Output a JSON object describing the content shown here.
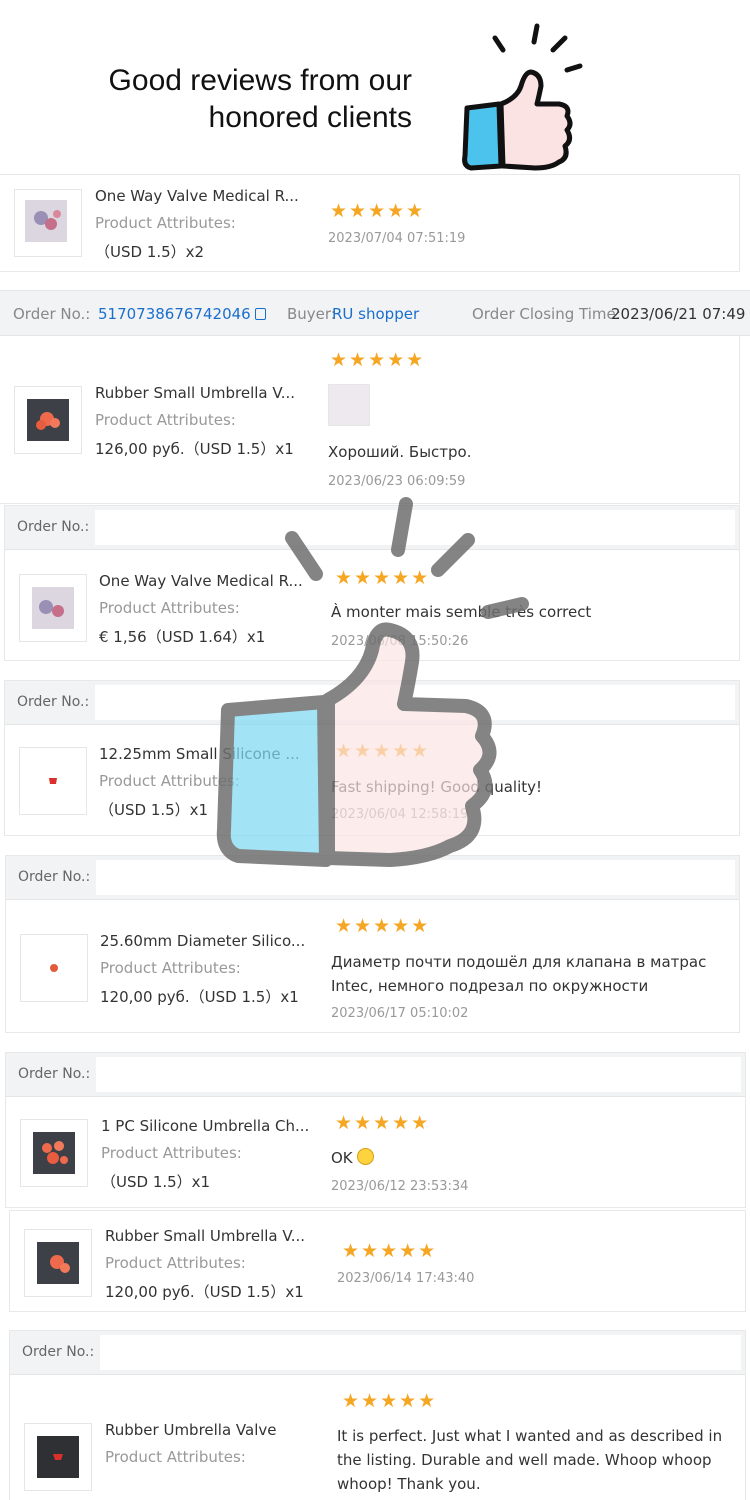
{
  "header": {
    "title_line1": "Good reviews from our",
    "title_line2": "honored clients"
  },
  "reviews": [
    {
      "name": "One Way Valve Medical R...",
      "attr": "Product Attributes:",
      "price": "（USD  1.5）x2",
      "stars": "★★★★★",
      "text": "",
      "date": "2023/07/04 07:51:19"
    },
    {
      "name": "Rubber Small Umbrella V...",
      "attr": "Product Attributes:",
      "price": "126,00 руб.（USD  1.5）x1",
      "stars": "★★★★★",
      "text": "Хороший. Быстро.",
      "date": "2023/06/23 06:09:59"
    },
    {
      "name": "One Way Valve Medical R...",
      "attr": "Product Attributes:",
      "price": "€ 1,56（USD  1.64）x1",
      "stars": "★★★★★",
      "text": "À monter mais semble très correct",
      "date": "2023/06/08 15:50:26"
    },
    {
      "name": "12.25mm Small Silicone ...",
      "attr": "Product Attributes:",
      "price": "（USD  1.5）x1",
      "stars": "★★★★★",
      "text": "Fast shipping! Good quality!",
      "date": "2023/06/04 12:58:19"
    },
    {
      "name": "25.60mm Diameter Silico...",
      "attr": "Product Attributes:",
      "price": "120,00 руб.（USD  1.5）x1",
      "stars": "★★★★★",
      "text": "Диаметр почти подошёл для клапана в матрас Intec, немного подрезал по окружности",
      "date": "2023/06/17 05:10:02"
    },
    {
      "name": "1 PC Silicone Umbrella Ch...",
      "attr": "Product Attributes:",
      "price": "（USD  1.5）x1",
      "stars": "★★★★★",
      "text": "OK",
      "date": "2023/06/12 23:53:34"
    },
    {
      "name": "Rubber Small Umbrella V...",
      "attr": "Product Attributes:",
      "price": "120,00 руб.（USD  1.5）x1",
      "stars": "★★★★★",
      "text": "",
      "date": "2023/06/14 17:43:40"
    },
    {
      "name": "Rubber Umbrella Valve",
      "attr": "Product Attributes:",
      "price": "",
      "stars": "★★★★★",
      "text": "It is perfect. Just what I wanted and as described in the listing. Durable and well made. Whoop whoop whoop! Thank you.",
      "date": ""
    }
  ],
  "order_info": {
    "order_label": "Order No.:",
    "order_number": "5170738676742046",
    "buyer_label": "Buyer:",
    "buyer_name": "RU shopper",
    "closing_label": "Order Closing Time:",
    "closing_time": "2023/06/21 07:49"
  },
  "order_bar_label": "Order No.:",
  "colors": {
    "star": "#f5a623",
    "link": "#1a6fcc",
    "thumb_blue": "#4cc3ec",
    "thumb_pink": "#fbe3e3"
  }
}
